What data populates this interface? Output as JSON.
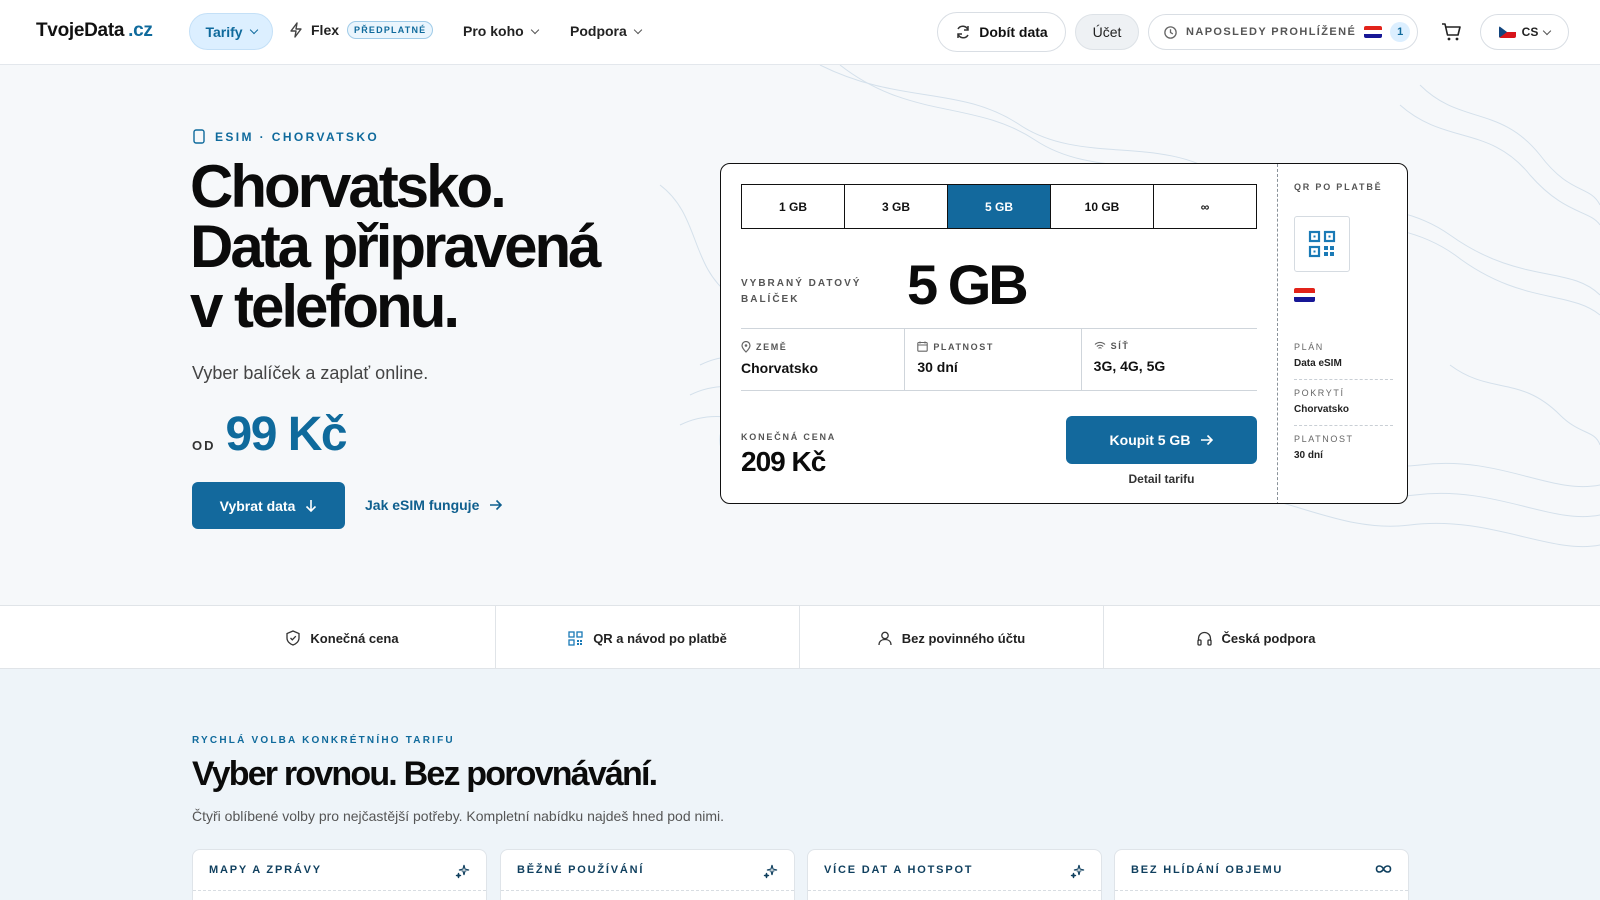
{
  "header": {
    "logo_main": "TvojeData",
    "logo_tld": ".cz",
    "nav_tarify": "Tarify",
    "nav_flex": "Flex",
    "nav_flex_badge": "PŘEDPLATNÉ",
    "nav_pro_koho": "Pro koho",
    "nav_podpora": "Podpora",
    "btn_dobit": "Dobít data",
    "btn_ucet": "Účet",
    "recent_label": "NAPOSLEDY PROHLÍŽENÉ",
    "recent_count": "1",
    "lang": "CS"
  },
  "hero": {
    "eyebrow": "ESIM · CHORVATSKO",
    "title_line1": "Chorvatsko.",
    "title_line2": "Data připravená",
    "title_line3": "v telefonu.",
    "subtitle": "Vyber balíček a zaplať online.",
    "price_prefix": "OD",
    "price_value": "99 Kč",
    "btn_select": "Vybrat data",
    "link_how": "Jak eSIM funguje"
  },
  "card": {
    "options": [
      "1 GB",
      "3 GB",
      "5 GB",
      "10 GB",
      "∞"
    ],
    "selected_index": 2,
    "selected_label": "VYBRANÝ DATOVÝ BALÍČEK",
    "selected_value": "5 GB",
    "country_cap": "ZEMĚ",
    "country_val": "Chorvatsko",
    "validity_cap": "PLATNOST",
    "validity_val": "30 dní",
    "network_cap": "SÍŤ",
    "network_val": "3G, 4G, 5G",
    "final_cap": "KONEČNÁ CENA",
    "final_val": "209 Kč",
    "btn_buy": "Koupit 5 GB",
    "detail_link": "Detail tarifu",
    "side_cap": "QR PO PLATBĚ",
    "plan_k": "PLÁN",
    "plan_v": "Data eSIM",
    "coverage_k": "POKRYTÍ",
    "coverage_v": "Chorvatsko",
    "validity_k": "PLATNOST",
    "validity_v": "30 dní"
  },
  "features": [
    "Konečná cena",
    "QR a návod po platbě",
    "Bez povinného účtu",
    "Česká podpora"
  ],
  "section": {
    "eyebrow": "RYCHLÁ VOLBA KONKRÉTNÍHO TARIFU",
    "title": "Vyber rovnou. Bez porovnávání.",
    "subtitle": "Čtyři oblíbené volby pro nejčastější potřeby. Kompletní nabídku najdeš hned pod nimi.",
    "cards": [
      "MAPY A ZPRÁVY",
      "BĚŽNÉ POUŽÍVÁNÍ",
      "VÍCE DAT A HOTSPOT",
      "BEZ HLÍDÁNÍ OBJEMU"
    ]
  },
  "colors": {
    "accent": "#13699d",
    "accent_light": "#dcefff"
  }
}
